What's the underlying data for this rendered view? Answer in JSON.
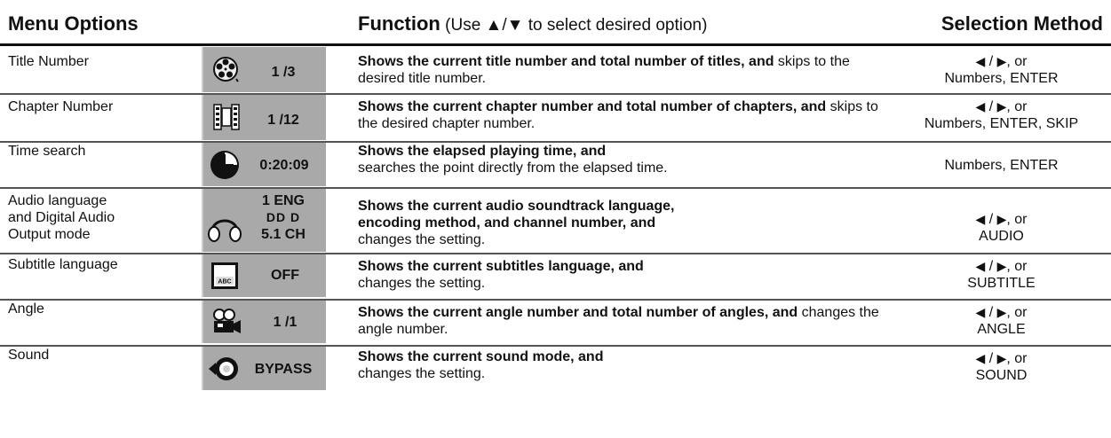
{
  "header": {
    "menu_options": "Menu Options",
    "function_bold": "Function",
    "function_note": " (Use ▲/▼ to select desired option)",
    "selection_method": "Selection Method"
  },
  "rows": [
    {
      "option": "Title Number",
      "icon": "film-reel-icon",
      "display": "1 /3",
      "fn_bold": "Shows the current title number and total number of titles, and",
      "fn_rest": " skips to the desired title number.",
      "sel_line1": " / ",
      "sel_line1_suffix": ", or",
      "sel_line2": "Numbers, ENTER"
    },
    {
      "option": "Chapter Number",
      "icon": "film-strip-icon",
      "display": "1 /12",
      "fn_bold": "Shows the current chapter number and total number of chapters, and",
      "fn_rest": " skips to the desired chapter number.",
      "sel_line1": " / ",
      "sel_line1_suffix": ", or",
      "sel_line2": "Numbers, ENTER, SKIP"
    },
    {
      "option": "Time search",
      "icon": "clock-icon",
      "display": "0:20:09",
      "fn_bold": "Shows the elapsed playing time, and",
      "fn_rest": "searches the point directly from the elapsed time.",
      "sel_line2": "Numbers, ENTER"
    },
    {
      "option_l1": "Audio language",
      "option_l2": "and Digital Audio",
      "option_l3": "Output mode",
      "icon": "headphones-icon",
      "display_l1": "1 ENG",
      "display_l2": "DD D",
      "display_l3": "5.1 CH",
      "fn_bold1": "Shows the current audio soundtrack language,",
      "fn_bold2": "encoding method, and channel number, and",
      "fn_rest": "changes the setting.",
      "sel_line1": " / ",
      "sel_line1_suffix": ", or",
      "sel_line2": "AUDIO"
    },
    {
      "option": "Subtitle language",
      "icon": "subtitle-abc-icon",
      "icon_text": "ABC",
      "display": "OFF",
      "fn_bold": "Shows the current subtitles language, and",
      "fn_rest": "changes the setting.",
      "sel_line1": " / ",
      "sel_line1_suffix": ", or",
      "sel_line2": "SUBTITLE"
    },
    {
      "option": "Angle",
      "icon": "camera-icon",
      "display": "1 /1",
      "fn_bold": "Shows the current angle number and total number of angles, and",
      "fn_rest": " changes the angle number.",
      "sel_line1": " / ",
      "sel_line1_suffix": ", or",
      "sel_line2": "ANGLE"
    },
    {
      "option": "Sound",
      "icon": "speaker-icon",
      "display": "BYPASS",
      "fn_bold": "Shows the current sound mode, and",
      "fn_rest": "changes the setting.",
      "sel_line1": " / ",
      "sel_line1_suffix": ", or",
      "sel_line2": "SOUND"
    }
  ]
}
